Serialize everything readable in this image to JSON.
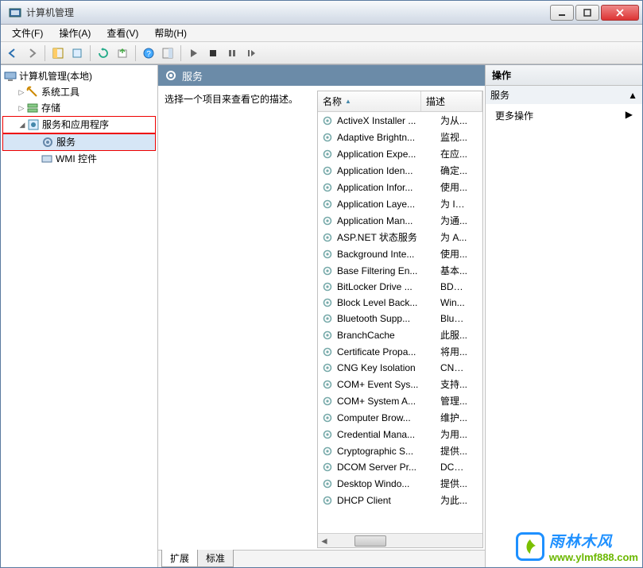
{
  "window": {
    "title": "计算机管理"
  },
  "menu": {
    "file": "文件(F)",
    "action": "操作(A)",
    "view": "查看(V)",
    "help": "帮助(H)"
  },
  "tree": {
    "root": "计算机管理(本地)",
    "system_tools": "系统工具",
    "storage": "存储",
    "services_apps": "服务和应用程序",
    "services": "服务",
    "wmi": "WMI 控件"
  },
  "servicesPanel": {
    "title": "服务",
    "desc": "选择一个项目来查看它的描述。",
    "col_name": "名称",
    "col_desc": "描述",
    "tabs": {
      "extended": "扩展",
      "standard": "标准"
    }
  },
  "actions": {
    "header": "操作",
    "section": "服务",
    "more": "更多操作"
  },
  "services": [
    {
      "name": "ActiveX Installer ...",
      "desc": "为从..."
    },
    {
      "name": "Adaptive Brightn...",
      "desc": "监视..."
    },
    {
      "name": "Application Expe...",
      "desc": "在应..."
    },
    {
      "name": "Application Iden...",
      "desc": "确定..."
    },
    {
      "name": "Application Infor...",
      "desc": "使用..."
    },
    {
      "name": "Application Laye...",
      "desc": "为 In..."
    },
    {
      "name": "Application Man...",
      "desc": "为通..."
    },
    {
      "name": "ASP.NET 状态服务",
      "desc": "为 A..."
    },
    {
      "name": "Background Inte...",
      "desc": "使用..."
    },
    {
      "name": "Base Filtering En...",
      "desc": "基本..."
    },
    {
      "name": "BitLocker Drive ...",
      "desc": "BDE..."
    },
    {
      "name": "Block Level Back...",
      "desc": "Win..."
    },
    {
      "name": "Bluetooth Supp...",
      "desc": "Blue..."
    },
    {
      "name": "BranchCache",
      "desc": "此服..."
    },
    {
      "name": "Certificate Propa...",
      "desc": "将用..."
    },
    {
      "name": "CNG Key Isolation",
      "desc": "CNG..."
    },
    {
      "name": "COM+ Event Sys...",
      "desc": "支持..."
    },
    {
      "name": "COM+ System A...",
      "desc": "管理..."
    },
    {
      "name": "Computer Brow...",
      "desc": "维护..."
    },
    {
      "name": "Credential Mana...",
      "desc": "为用..."
    },
    {
      "name": "Cryptographic S...",
      "desc": "提供..."
    },
    {
      "name": "DCOM Server Pr...",
      "desc": "DCO..."
    },
    {
      "name": "Desktop Windo...",
      "desc": "提供..."
    },
    {
      "name": "DHCP Client",
      "desc": "为此..."
    }
  ],
  "watermark": {
    "brand": "雨林木风",
    "url": "www.ylmf888.com"
  }
}
